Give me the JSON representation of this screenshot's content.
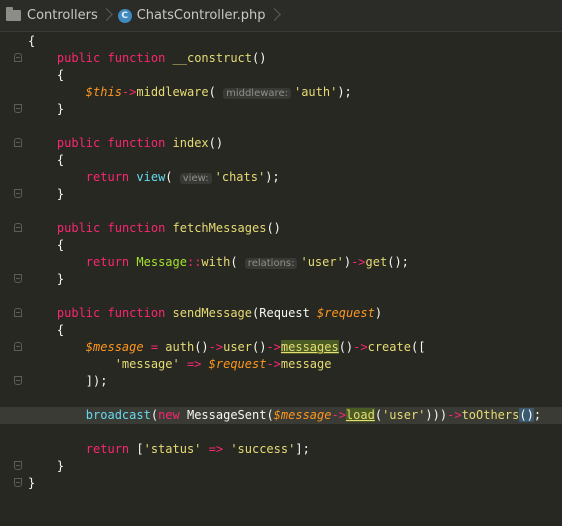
{
  "breadcrumb": {
    "folder": "Controllers",
    "file": "ChatsController.php",
    "file_icon_letter": "C"
  },
  "code": {
    "l1": "{",
    "l2_kw1": "public",
    "l2_kw2": "function",
    "l2_name": "__construct",
    "l2_rest": "()",
    "l3": "{",
    "l4_var": "$this",
    "l4_arrow": "->",
    "l4_call": "middleware",
    "l4_open": "(",
    "l4_hint": "middleware:",
    "l4_str": "'auth'",
    "l4_close": ");",
    "l5": "}",
    "l7_kw1": "public",
    "l7_kw2": "function",
    "l7_name": "index",
    "l7_rest": "()",
    "l8": "{",
    "l9_kw": "return",
    "l9_call": "view",
    "l9_open": "(",
    "l9_hint": "view:",
    "l9_str": "'chats'",
    "l9_close": ");",
    "l10": "}",
    "l12_kw1": "public",
    "l12_kw2": "function",
    "l12_name": "fetchMessages",
    "l12_rest": "()",
    "l13": "{",
    "l14_kw": "return",
    "l14_cls": "Message",
    "l14_sep": "::",
    "l14_call": "with",
    "l14_open": "(",
    "l14_hint": "relations:",
    "l14_str": "'user'",
    "l14_mid": ")",
    "l14_arrow": "->",
    "l14_call2": "get",
    "l14_close": "();",
    "l15": "}",
    "l17_kw1": "public",
    "l17_kw2": "function",
    "l17_name": "sendMessage",
    "l17_open": "(Request ",
    "l17_var": "$request",
    "l17_close": ")",
    "l18": "{",
    "l19_var": "$message",
    "l19_eq": " = ",
    "l19_call": "auth",
    "l19_p1": "()",
    "l19_a1": "->",
    "l19_c2": "user",
    "l19_p2": "()",
    "l19_a2": "->",
    "l19_c3": "messages",
    "l19_p3": "()",
    "l19_a3": "->",
    "l19_c4": "create",
    "l19_p4": "([",
    "l20_str": "'message'",
    "l20_op": " => ",
    "l20_var": "$request",
    "l20_arrow": "->",
    "l20_prop": "message",
    "l21": "]);",
    "l23_call": "broadcast",
    "l23_open": "(",
    "l23_kw": "new",
    "l23_cls": " MessageSent(",
    "l23_var": "$message",
    "l23_arrow": "->",
    "l23_load": "load",
    "l23_lp": "(",
    "l23_str": "'user'",
    "l23_rp": ")))",
    "l23_arrow2": "->",
    "l23_call2": "toOthers",
    "l23_paren": "()",
    "l23_semi": ";",
    "l25_kw": "return",
    "l25_open": " [",
    "l25_s1": "'status'",
    "l25_op": " => ",
    "l25_s2": "'success'",
    "l25_close": "];",
    "l26": "}",
    "l27": "}"
  }
}
